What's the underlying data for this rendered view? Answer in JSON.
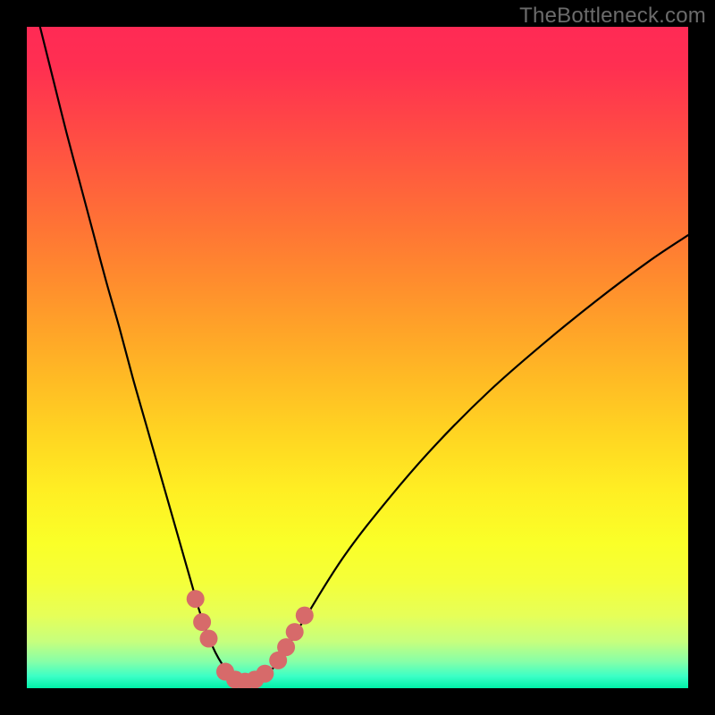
{
  "watermark": "TheBottleneck.com",
  "colors": {
    "frame": "#000000",
    "curve_stroke": "#000000",
    "marker_fill": "#d76a6a",
    "watermark_text": "#6b6b6b"
  },
  "gradient_stops": [
    {
      "offset": 0.0,
      "color": "#ff2a55"
    },
    {
      "offset": 0.06,
      "color": "#ff2f51"
    },
    {
      "offset": 0.14,
      "color": "#ff4547"
    },
    {
      "offset": 0.22,
      "color": "#ff5c3e"
    },
    {
      "offset": 0.3,
      "color": "#ff7335"
    },
    {
      "offset": 0.38,
      "color": "#ff8b2e"
    },
    {
      "offset": 0.46,
      "color": "#ffa428"
    },
    {
      "offset": 0.54,
      "color": "#ffbd24"
    },
    {
      "offset": 0.62,
      "color": "#ffd622"
    },
    {
      "offset": 0.7,
      "color": "#ffee23"
    },
    {
      "offset": 0.78,
      "color": "#faff28"
    },
    {
      "offset": 0.84,
      "color": "#f4ff3a"
    },
    {
      "offset": 0.89,
      "color": "#e6ff58"
    },
    {
      "offset": 0.93,
      "color": "#c6ff7e"
    },
    {
      "offset": 0.96,
      "color": "#86ffa8"
    },
    {
      "offset": 0.982,
      "color": "#3bffc6"
    },
    {
      "offset": 1.0,
      "color": "#00f0a8"
    }
  ],
  "chart_data": {
    "type": "line",
    "title": "",
    "xlabel": "",
    "ylabel": "",
    "xlim": [
      0,
      100
    ],
    "ylim": [
      0,
      100
    ],
    "grid": false,
    "series": [
      {
        "name": "bottleneck-curve",
        "x": [
          2,
          4,
          6,
          8,
          10,
          12,
          14,
          16,
          18,
          20,
          22,
          23,
          24,
          25,
          26,
          27,
          28,
          29,
          30,
          31,
          32,
          33,
          34,
          35,
          36,
          38,
          42,
          48,
          55,
          62,
          70,
          78,
          86,
          94,
          100
        ],
        "y": [
          100,
          92,
          84,
          76.5,
          69,
          61.5,
          54.5,
          47,
          40,
          33,
          26,
          22.5,
          19,
          15.5,
          12,
          9,
          6.5,
          4.5,
          3,
          2,
          1.3,
          1,
          1,
          1.3,
          2,
          4,
          10.5,
          20,
          29,
          37,
          45,
          52,
          58.5,
          64.5,
          68.5
        ]
      }
    ],
    "markers": [
      {
        "name": "left-cluster-1",
        "x": 25.5,
        "y": 13.5
      },
      {
        "name": "left-cluster-2",
        "x": 26.5,
        "y": 10.0
      },
      {
        "name": "left-cluster-3",
        "x": 27.5,
        "y": 7.5
      },
      {
        "name": "trough-1",
        "x": 30.0,
        "y": 2.5
      },
      {
        "name": "trough-2",
        "x": 31.5,
        "y": 1.3
      },
      {
        "name": "trough-3",
        "x": 33.0,
        "y": 1.0
      },
      {
        "name": "trough-4",
        "x": 34.5,
        "y": 1.3
      },
      {
        "name": "trough-5",
        "x": 36.0,
        "y": 2.2
      },
      {
        "name": "right-cluster-1",
        "x": 38.0,
        "y": 4.2
      },
      {
        "name": "right-cluster-2",
        "x": 39.2,
        "y": 6.2
      },
      {
        "name": "right-cluster-3",
        "x": 40.5,
        "y": 8.5
      },
      {
        "name": "right-cluster-4",
        "x": 42.0,
        "y": 11.0
      }
    ]
  }
}
